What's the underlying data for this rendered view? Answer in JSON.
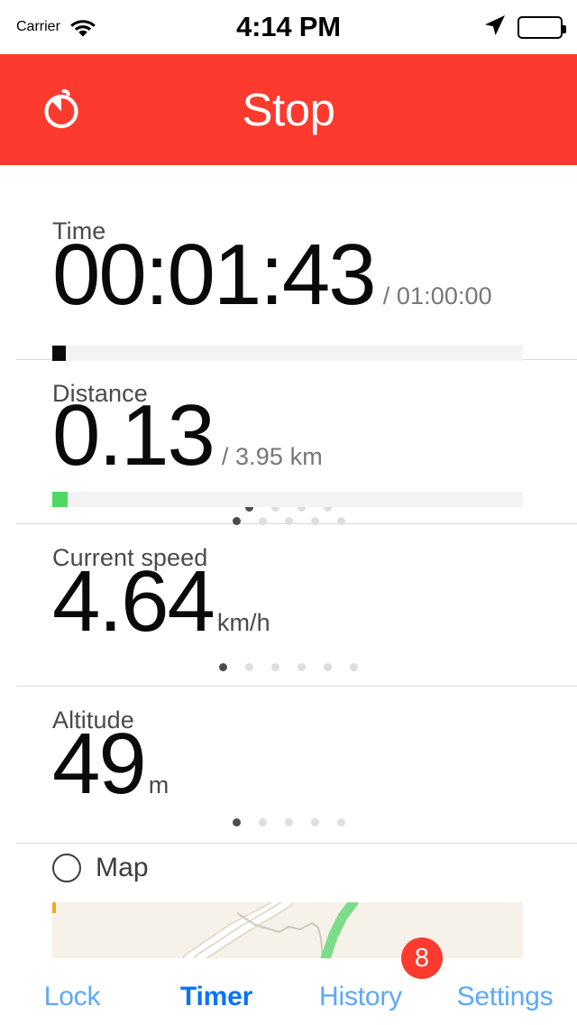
{
  "status_bar": {
    "carrier": "Carrier",
    "time": "4:14 PM",
    "wifi_icon": "wifi-icon",
    "location_icon": "location-arrow-icon",
    "battery_icon": "battery-full-icon"
  },
  "nav_bar": {
    "title": "Stop",
    "icon": "stopwatch-icon",
    "background_color": "#fc3a2d",
    "title_color": "#ffffff"
  },
  "metrics": [
    {
      "id": "time",
      "label": "Time",
      "value": "00:01:43",
      "target": "/ 01:00:00",
      "progress_percent": 2.9,
      "progress_color": "#0a0a0a",
      "track_color": "#f3f3f3",
      "dots_total": 4,
      "dots_active_index": 0
    },
    {
      "id": "distance",
      "label": "Distance",
      "value": "0.13",
      "target": "/ 3.95 km",
      "progress_percent": 3.3,
      "progress_color": "#4fd964",
      "track_color": "#f3f3f3",
      "dots_total": 5,
      "dots_active_index": 0
    },
    {
      "id": "speed",
      "label": "Current speed",
      "value": "4.64",
      "unit": "km/h",
      "dots_total": 6,
      "dots_active_index": 0
    },
    {
      "id": "altitude",
      "label": "Altitude",
      "value": "49",
      "unit": "m",
      "dots_total": 5,
      "dots_active_index": 0
    }
  ],
  "map_section": {
    "label": "Map",
    "checked": false,
    "radio_icon": "circle-unchecked-icon",
    "map_background_color": "#f6f1e9",
    "trail_color": "#7ddc8a",
    "road_color": "#ffffff"
  },
  "tab_bar": {
    "tabs": [
      {
        "label": "Lock",
        "active": false
      },
      {
        "label": "Timer",
        "active": true
      },
      {
        "label": "History",
        "active": false
      },
      {
        "label": "Settings",
        "active": false
      }
    ],
    "badge": "8",
    "badge_color": "#fc3a2d",
    "active_color": "#0a72f5",
    "inactive_color": "#5da8fb"
  }
}
